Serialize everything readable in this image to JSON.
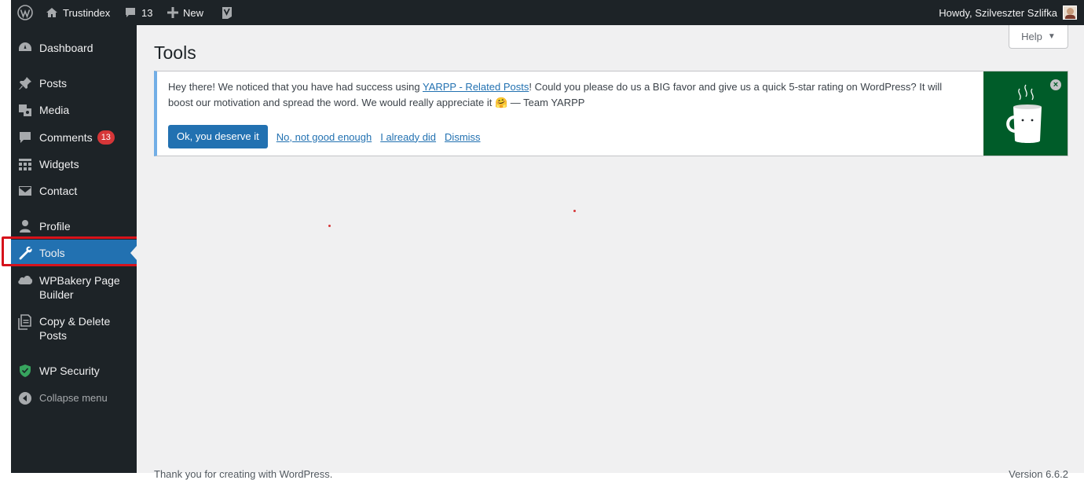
{
  "adminbar": {
    "site_name": "Trustindex",
    "comments_count": "13",
    "new_label": "New",
    "greeting": "Howdy, Szilveszter Szlifka"
  },
  "sidebar": {
    "items": [
      {
        "label": "Dashboard",
        "icon": "dashboard-icon"
      },
      {
        "label": "Posts",
        "icon": "pin-icon"
      },
      {
        "label": "Media",
        "icon": "media-icon"
      },
      {
        "label": "Comments",
        "icon": "comment-icon",
        "badge": "13"
      },
      {
        "label": "Widgets",
        "icon": "widgets-icon"
      },
      {
        "label": "Contact",
        "icon": "envelope-icon"
      },
      {
        "label": "Profile",
        "icon": "user-icon"
      },
      {
        "label": "Tools",
        "icon": "wrench-icon"
      },
      {
        "label": "WPBakery Page Builder",
        "icon": "cloud-icon"
      },
      {
        "label": "Copy & Delete Posts",
        "icon": "copy-icon"
      },
      {
        "label": "WP Security",
        "icon": "shield-icon"
      }
    ],
    "collapse_label": "Collapse menu"
  },
  "page": {
    "title": "Tools",
    "help_label": "Help"
  },
  "notice": {
    "text_before": "Hey there! We noticed that you have had success using ",
    "link_text": "YARPP - Related Posts",
    "text_after": "! Could you please do us a BIG favor and give us a quick 5-star rating on WordPress? It will boost our motivation and spread the word. We would really appreciate it 🤗 — Team YARPP",
    "primary_button": "Ok, you deserve it",
    "link_no": "No, not good enough",
    "link_did": "I already did",
    "link_dismiss": "Dismiss"
  },
  "footer": {
    "left": "Thank you for creating with WordPress.",
    "right": "Version 6.6.2"
  },
  "colors": {
    "admin_bg": "#1d2327",
    "accent": "#2271b1",
    "badge": "#d63638",
    "highlight": "#d6121b",
    "coffee_bg": "#005c29"
  }
}
